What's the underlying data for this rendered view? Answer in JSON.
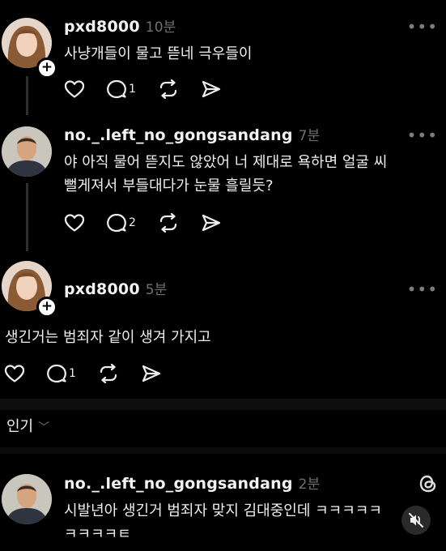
{
  "comments": [
    {
      "username": "pxd8000",
      "time": "10분",
      "text_lines": [
        "사냥개들이 물고 뜯네 극우들이"
      ],
      "like_count": "",
      "reply_count": "1",
      "has_follow_button": true
    },
    {
      "username": "no._.left_no_gongsandang",
      "time": "7분",
      "text_lines": [
        "야 아직 물어 뜯지도 않았어 너 제대로 욕하면 얼굴 씨",
        "뻘게져서 부들대다가 눈물 흘릴듯?"
      ],
      "like_count": "",
      "reply_count": "2",
      "has_follow_button": false
    },
    {
      "username": "pxd8000",
      "time": "5분",
      "text_lines": [
        "생긴거는 범죄자 같이 생겨 가지고"
      ],
      "like_count": "",
      "reply_count": "1",
      "has_follow_button": true
    }
  ],
  "sort": {
    "label": "인기",
    "chevron": "﹀"
  },
  "bottom_comment": {
    "username": "no._.left_no_gongsandang",
    "time": "2분",
    "text_lines": [
      "시발년아 생긴거 범죄자 맞지 김대중인데 ㅋㅋㅋㅋㅋ",
      "ㅋㅋㅋㅋㅌ"
    ]
  },
  "more_glyph": "•••",
  "plus_glyph": "+",
  "icons": [
    "heart-icon",
    "comment-icon",
    "repost-icon",
    "share-icon",
    "threads-logo-icon",
    "mute-icon"
  ]
}
